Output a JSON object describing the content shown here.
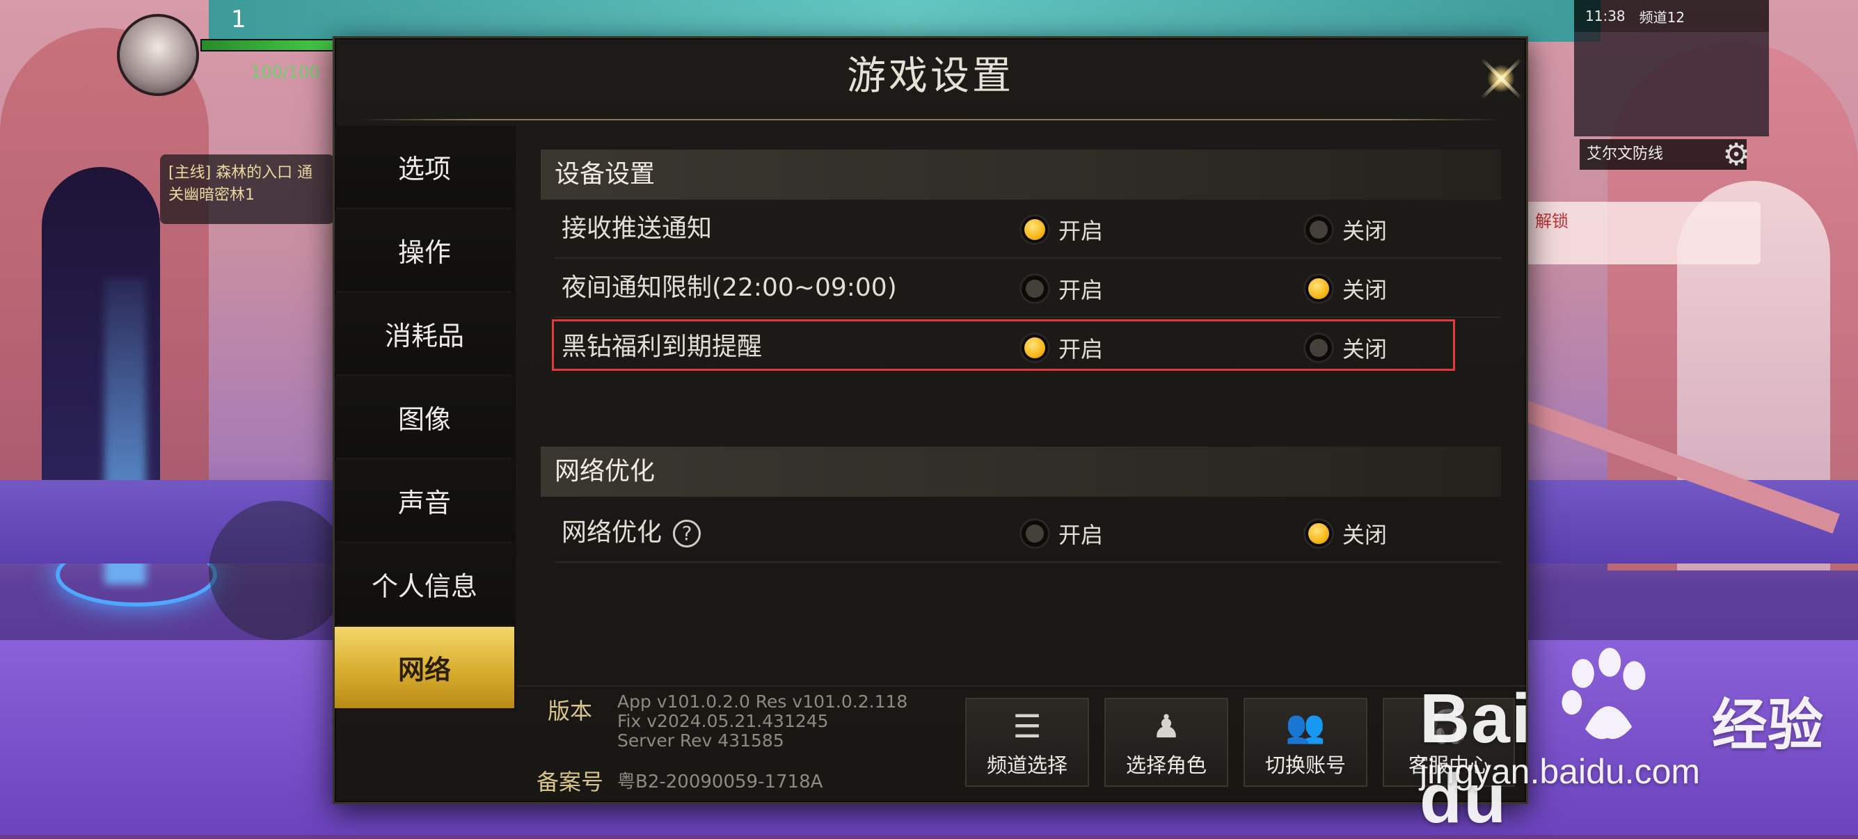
{
  "hud": {
    "level": "1",
    "hp_text": "100/100",
    "quest_text": "[主线] 森林的入口 通关幽暗密林1",
    "status_time": "11:38",
    "status_channel": "频道12",
    "minimap_label": "艾尔文防线",
    "unlock_text": "解锁"
  },
  "dialog": {
    "title": "游戏设置",
    "sidebar": [
      {
        "label": "选项"
      },
      {
        "label": "操作"
      },
      {
        "label": "消耗品"
      },
      {
        "label": "图像"
      },
      {
        "label": "声音"
      },
      {
        "label": "个人信息"
      },
      {
        "label": "网络"
      }
    ],
    "sections": [
      {
        "header": "设备设置",
        "rows": [
          {
            "label": "接收推送通知",
            "on_label": "开启",
            "off_label": "关闭",
            "selected": "on"
          },
          {
            "label": "夜间通知限制(22:00~09:00)",
            "on_label": "开启",
            "off_label": "关闭",
            "selected": "off"
          },
          {
            "label": "黑钻福利到期提醒",
            "on_label": "开启",
            "off_label": "关闭",
            "selected": "on"
          }
        ]
      },
      {
        "header": "网络优化",
        "rows": [
          {
            "label": "网络优化",
            "on_label": "开启",
            "off_label": "关闭",
            "selected": "off",
            "help_icon": "?"
          }
        ]
      }
    ],
    "footer": {
      "version_label": "版本",
      "version_lines": [
        "App v101.0.2.0 Res v101.0.2.118",
        "Fix v2024.05.21.431245",
        "Server Rev 431585"
      ],
      "record_label": "备案号",
      "record_value": "粤B2-20090059-1718A",
      "buttons": [
        {
          "label": "频道选择",
          "icon": "list-icon"
        },
        {
          "label": "选择角色",
          "icon": "character-icon"
        },
        {
          "label": "切换账号",
          "icon": "users-icon"
        },
        {
          "label": "客服中心",
          "icon": "headset-icon"
        }
      ]
    }
  },
  "watermark": {
    "brand": "Bai du",
    "cn": "经验",
    "url": "jingyan.baidu.com"
  },
  "colors": {
    "accent": "#f7b71a",
    "active_tab": "#e2bd45",
    "highlight_border": "#e33b3b"
  }
}
